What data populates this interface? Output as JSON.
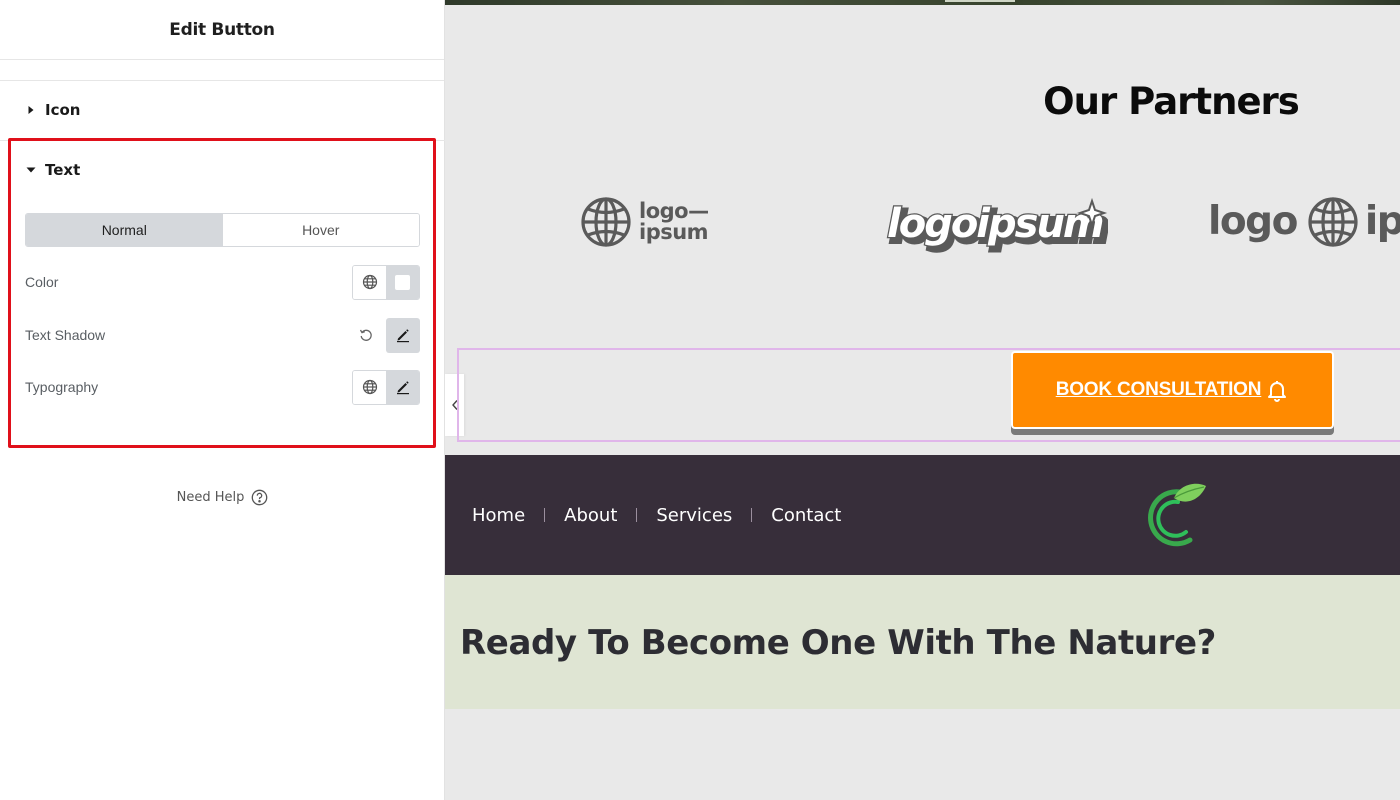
{
  "panel": {
    "title": "Edit Button",
    "sections": {
      "icon": {
        "label": "Icon",
        "expanded": false
      },
      "text": {
        "label": "Text",
        "expanded": true
      }
    },
    "state_tabs": {
      "normal": "Normal",
      "hover": "Hover",
      "active": "Normal"
    },
    "controls": {
      "color": {
        "label": "Color",
        "value": "#ffffff",
        "icons": [
          "globe-icon",
          "color-swatch"
        ]
      },
      "text_shadow": {
        "label": "Text Shadow",
        "icons": [
          "reset-icon",
          "pencil-icon"
        ]
      },
      "typography": {
        "label": "Typography",
        "icons": [
          "globe-icon",
          "pencil-icon"
        ]
      }
    },
    "help": {
      "label": "Need Help",
      "icon": "question-circle-icon"
    },
    "highlight_color": "#e0101a"
  },
  "site": {
    "partners": {
      "title": "Our Partners",
      "logos": [
        {
          "name": "logo-ipsum-globe",
          "line1": "logo—",
          "line2": "ipsum"
        },
        {
          "name": "logoipsum-wordmark",
          "text": "logoipsum"
        },
        {
          "name": "logo-ipsum-partial",
          "word1": "logo",
          "word2": "ips"
        }
      ]
    },
    "cta_button": {
      "label": "BOOK CONSULTATION",
      "icon": "bell-icon",
      "background": "#ff8a00"
    },
    "footer": {
      "nav": [
        "Home",
        "About",
        "Services",
        "Contact"
      ],
      "logo_icon": "leaf-logo-icon",
      "background": "#372e3a"
    },
    "band": {
      "title": "Ready To Become One With The Nature?",
      "background": "#dfe5d3"
    }
  }
}
